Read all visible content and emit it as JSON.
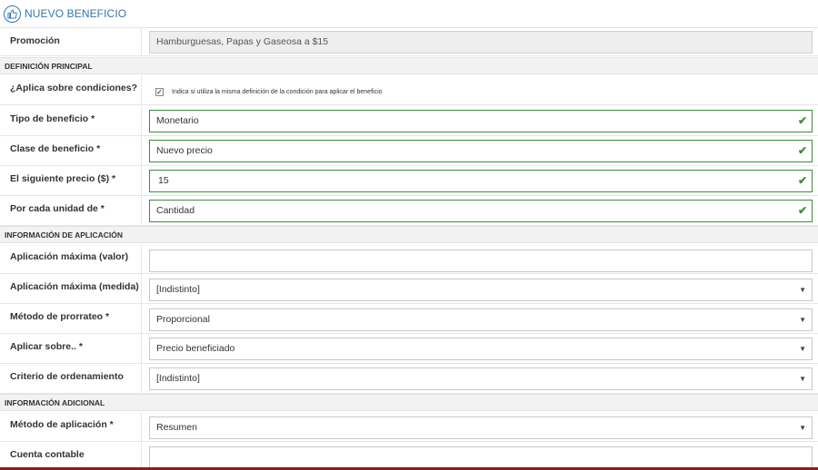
{
  "header": {
    "title": "NUEVO BENEFICIO",
    "icon": "thumbs-up-icon"
  },
  "promotion": {
    "label": "Promoción",
    "value": "Hamburguesas, Papas y Gaseosa a $15"
  },
  "sections": {
    "principal": "DEFINICIÓN PRINCIPAL",
    "aplicacion": "INFORMACIÓN DE APLICACIÓN",
    "adicional": "INFORMACIÓN ADICIONAL"
  },
  "principal": {
    "aplica_label": "¿Aplica sobre condiciones?",
    "aplica_checked": true,
    "aplica_help": "Indica si utiliza la misma definición de la condición para aplicar el beneficio",
    "tipo_label": "Tipo de beneficio *",
    "tipo_value": "Monetario",
    "clase_label": "Clase de beneficio *",
    "clase_value": "Nuevo precio",
    "precio_label": "El siguiente precio ($) *",
    "precio_value": "15",
    "unidad_label": "Por cada unidad de *",
    "unidad_value": "Cantidad"
  },
  "aplicacion": {
    "max_valor_label": "Aplicación máxima (valor)",
    "max_valor_value": "",
    "max_medida_label": "Aplicación máxima (medida)",
    "max_medida_value": "[Indistinto]",
    "prorrateo_label": "Método de prorrateo *",
    "prorrateo_value": "Proporcional",
    "aplicar_label": "Aplicar sobre.. *",
    "aplicar_value": "Precio beneficiado",
    "criterio_label": "Criterio de ordenamiento",
    "criterio_value": "[Indistinto]"
  },
  "adicional": {
    "metodo_label": "Método de aplicación *",
    "metodo_value": "Resumen",
    "cuenta_label": "Cuenta contable",
    "cuenta_value": ""
  },
  "colors": {
    "accent": "#3276b1",
    "valid": "#3c8d3c",
    "bottom_bar": "#8b1c1c"
  }
}
